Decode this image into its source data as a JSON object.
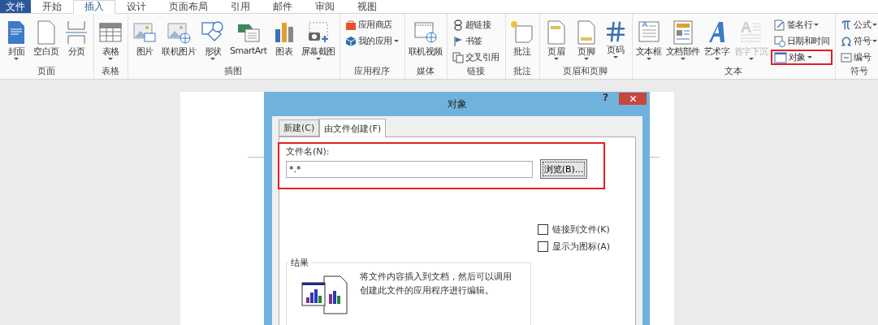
{
  "menu_tabs": [
    {
      "label": "文件",
      "kind": "file",
      "selected": false
    },
    {
      "label": "开始",
      "kind": "tab",
      "selected": false
    },
    {
      "label": "插入",
      "kind": "tab",
      "selected": true
    },
    {
      "label": "设计",
      "kind": "tab",
      "selected": false
    },
    {
      "label": "页面布局",
      "kind": "tab",
      "selected": false
    },
    {
      "label": "引用",
      "kind": "tab",
      "selected": false
    },
    {
      "label": "邮件",
      "kind": "tab",
      "selected": false
    },
    {
      "label": "审阅",
      "kind": "tab",
      "selected": false
    },
    {
      "label": "视图",
      "kind": "tab",
      "selected": false
    }
  ],
  "ribbon_groups": [
    {
      "label": "页面",
      "items": [
        {
          "label": "封面",
          "kind": "large",
          "dropdown": true,
          "disabled": false,
          "highlighted": false
        },
        {
          "label": "空白页",
          "kind": "large",
          "dropdown": false,
          "disabled": false,
          "highlighted": false
        },
        {
          "label": "分页",
          "kind": "large",
          "dropdown": false,
          "disabled": false,
          "highlighted": false
        }
      ]
    },
    {
      "label": "表格",
      "items": [
        {
          "label": "表格",
          "kind": "large",
          "dropdown": true,
          "disabled": false,
          "highlighted": false
        }
      ]
    },
    {
      "label": "插图",
      "items": [
        {
          "label": "图片",
          "kind": "large",
          "dropdown": false,
          "disabled": false,
          "highlighted": false
        },
        {
          "label": "联机图片",
          "kind": "large",
          "dropdown": false,
          "disabled": false,
          "highlighted": false
        },
        {
          "label": "形状",
          "kind": "large",
          "dropdown": true,
          "disabled": false,
          "highlighted": false
        },
        {
          "label": "SmartArt",
          "kind": "large",
          "dropdown": false,
          "disabled": false,
          "highlighted": false
        },
        {
          "label": "图表",
          "kind": "large",
          "dropdown": false,
          "disabled": false,
          "highlighted": false
        },
        {
          "label": "屏幕截图",
          "kind": "large",
          "dropdown": true,
          "disabled": false,
          "highlighted": false
        }
      ]
    },
    {
      "label": "应用程序",
      "items": [
        {
          "label": "应用商店",
          "kind": "small",
          "dropdown": false,
          "disabled": false,
          "highlighted": false
        },
        {
          "label": "我的应用",
          "kind": "small",
          "dropdown": true,
          "disabled": false,
          "highlighted": false
        }
      ]
    },
    {
      "label": "媒体",
      "items": [
        {
          "label": "联机视频",
          "kind": "large",
          "dropdown": false,
          "disabled": false,
          "highlighted": false
        }
      ]
    },
    {
      "label": "链接",
      "items": [
        {
          "label": "超链接",
          "kind": "small",
          "dropdown": false,
          "disabled": false,
          "highlighted": false
        },
        {
          "label": "书签",
          "kind": "small",
          "dropdown": false,
          "disabled": false,
          "highlighted": false
        },
        {
          "label": "交叉引用",
          "kind": "small",
          "dropdown": false,
          "disabled": false,
          "highlighted": false
        }
      ]
    },
    {
      "label": "批注",
      "items": [
        {
          "label": "批注",
          "kind": "large",
          "dropdown": false,
          "disabled": false,
          "highlighted": false
        }
      ]
    },
    {
      "label": "页眉和页脚",
      "items": [
        {
          "label": "页眉",
          "kind": "large",
          "dropdown": true,
          "disabled": false,
          "highlighted": false
        },
        {
          "label": "页脚",
          "kind": "large",
          "dropdown": true,
          "disabled": false,
          "highlighted": false
        },
        {
          "label": "页码",
          "kind": "large",
          "dropdown": true,
          "disabled": false,
          "highlighted": false
        }
      ]
    },
    {
      "label": "文本",
      "items": [
        {
          "label": "文本框",
          "kind": "large",
          "dropdown": true,
          "disabled": false,
          "highlighted": false
        },
        {
          "label": "文档部件",
          "kind": "large",
          "dropdown": true,
          "disabled": false,
          "highlighted": false
        },
        {
          "label": "艺术字",
          "kind": "large",
          "dropdown": true,
          "disabled": false,
          "highlighted": false
        },
        {
          "label": "首字下沉",
          "kind": "large",
          "dropdown": true,
          "disabled": true,
          "highlighted": false
        },
        {
          "label": "签名行",
          "kind": "small",
          "dropdown": true,
          "disabled": false,
          "highlighted": false
        },
        {
          "label": "日期和时间",
          "kind": "small",
          "dropdown": false,
          "disabled": false,
          "highlighted": false
        },
        {
          "label": "对象",
          "kind": "small",
          "dropdown": true,
          "disabled": false,
          "highlighted": true
        }
      ]
    },
    {
      "label": "符号",
      "items": [
        {
          "label": "公式",
          "kind": "small",
          "dropdown": true,
          "disabled": false,
          "highlighted": false
        },
        {
          "label": "符号",
          "kind": "small",
          "dropdown": true,
          "disabled": false,
          "highlighted": false
        },
        {
          "label": "编号",
          "kind": "small",
          "dropdown": false,
          "disabled": false,
          "highlighted": false
        }
      ]
    }
  ],
  "dialog": {
    "title": "对象",
    "help": "?",
    "tabs": [
      {
        "label": "新建(C)",
        "selected": false
      },
      {
        "label": "由文件创建(F)",
        "selected": true
      }
    ],
    "file_name": {
      "label": "文件名(N):",
      "value": "*.*",
      "highlighted": true
    },
    "browse_button": "浏览(B)...",
    "options": [
      {
        "label": "链接到文件(K)",
        "checked": false
      },
      {
        "label": "显示为图标(A)",
        "checked": false
      }
    ],
    "result": {
      "title": "结果",
      "text": "将文件内容插入到文档，然后可以调用创建此文件的应用程序进行编辑。"
    }
  }
}
